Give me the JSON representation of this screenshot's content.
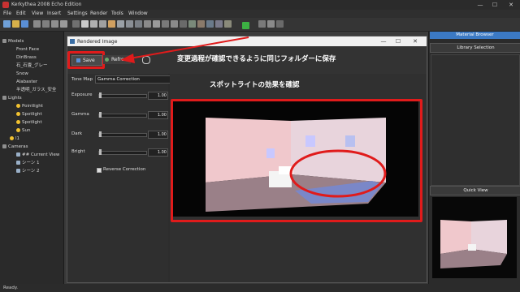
{
  "window": {
    "title": "Kerkythea 2008 Echo Edition",
    "minimize": "—",
    "maximize": "☐",
    "close": "✕"
  },
  "menu": {
    "items": [
      "File",
      "Edit",
      "View",
      "Insert",
      "Settings",
      "Render",
      "Tools",
      "Window"
    ]
  },
  "sidebar": {
    "models_label": "Models",
    "models": [
      "Front Face",
      "DiriBrass",
      "石_石畳_グレー",
      "Snow",
      "Alabaster",
      "半透明_ガラス_安全"
    ],
    "lights_label": "Lights",
    "lights": [
      "Pointlight",
      "Spotlight",
      "Spotlight",
      "Sun",
      "l1"
    ],
    "cameras_label": "Cameras",
    "cameras": [
      "## Current View",
      "シーン 1",
      "シーン 2"
    ]
  },
  "dialog": {
    "title": "Rendered Image",
    "minimize": "—",
    "maximize": "☐",
    "close": "✕",
    "save_label": "Save",
    "refresh_label": "Refresh",
    "tone_map_label": "Tone Map",
    "tone_map_value": "Gamma Correction",
    "exposure_label": "Exposure",
    "exposure_value": "1.00",
    "gamma_label": "Gamma",
    "gamma_value": "1.00",
    "dark_label": "Dark",
    "dark_value": "1.00",
    "bright_label": "Bright",
    "bright_value": "1.00",
    "reverse_correction_label": "Reverse Correction",
    "reverse_correction_checked": true
  },
  "annotations": {
    "text1": "変更過程が確認できるように同じフォルダーに保存",
    "text2": "スポットライトの効果を確認"
  },
  "right_panel": {
    "material_browser": "Material Browser",
    "library_selection": "Library Selection",
    "quick_view": "Quick View"
  },
  "status": {
    "text": "Ready."
  },
  "colors": {
    "annotation_red": "#e01b1b",
    "accent_blue": "#3b79c4"
  }
}
